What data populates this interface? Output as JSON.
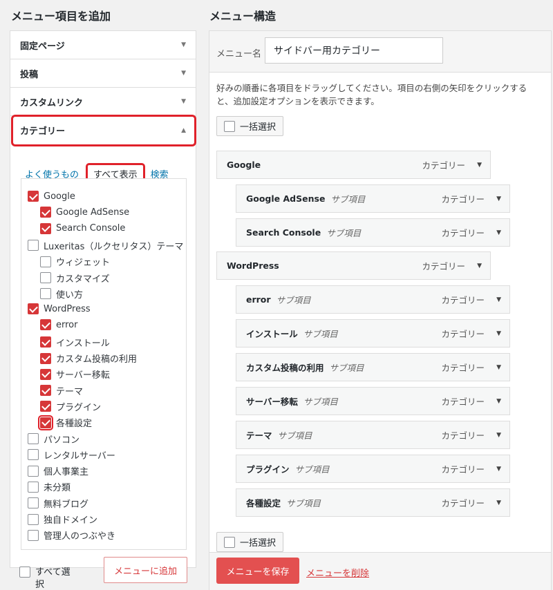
{
  "left": {
    "title": "メニュー項目を追加",
    "panels": [
      "固定ページ",
      "投稿",
      "カスタムリンク",
      "カテゴリー"
    ],
    "tabs": {
      "recent": "よく使うもの",
      "all": "すべて表示",
      "search": "検索"
    },
    "items": [
      {
        "label": "Google",
        "checked": true
      },
      {
        "label": "Google AdSense",
        "checked": true
      },
      {
        "label": "Search Console",
        "checked": true
      },
      {
        "label": "Luxeritas（ルクセリタス）テーマ",
        "checked": false
      },
      {
        "label": "ウィジェット",
        "checked": false
      },
      {
        "label": "カスタマイズ",
        "checked": false
      },
      {
        "label": "使い方",
        "checked": false
      },
      {
        "label": "WordPress",
        "checked": true
      },
      {
        "label": "error",
        "checked": true
      },
      {
        "label": "インストール",
        "checked": true
      },
      {
        "label": "カスタム投稿の利用",
        "checked": true
      },
      {
        "label": "サーバー移転",
        "checked": true
      },
      {
        "label": "テーマ",
        "checked": true
      },
      {
        "label": "プラグイン",
        "checked": true
      },
      {
        "label": "各種設定",
        "checked": true
      },
      {
        "label": "パソコン",
        "checked": false
      },
      {
        "label": "レンタルサーバー",
        "checked": false
      },
      {
        "label": "個人事業主",
        "checked": false
      },
      {
        "label": "未分類",
        "checked": false
      },
      {
        "label": "無料ブログ",
        "checked": false
      },
      {
        "label": "独自ドメイン",
        "checked": false
      },
      {
        "label": "管理人のつぶやき",
        "checked": false
      }
    ],
    "select_all": "すべて選択",
    "add_button": "メニューに追加"
  },
  "right": {
    "title": "メニュー構造",
    "name_label": "メニュー名",
    "name_value": "サイドバー用カテゴリー",
    "instructions": "好みの順番に各項目をドラッグしてください。項目の右側の矢印をクリックすると、追加設定オプションを表示できます。",
    "bulk_select": "一括選択",
    "menu_items": [
      {
        "title": "Google",
        "sub": "",
        "type": "カテゴリー"
      },
      {
        "title": "Google AdSense",
        "sub": "サブ項目",
        "type": "カテゴリー"
      },
      {
        "title": "Search Console",
        "sub": "サブ項目",
        "type": "カテゴリー"
      },
      {
        "title": "WordPress",
        "sub": "",
        "type": "カテゴリー"
      },
      {
        "title": "error",
        "sub": "サブ項目",
        "type": "カテゴリー"
      },
      {
        "title": "インストール",
        "sub": "サブ項目",
        "type": "カテゴリー"
      },
      {
        "title": "カスタム投稿の利用",
        "sub": "サブ項目",
        "type": "カテゴリー"
      },
      {
        "title": "サーバー移転",
        "sub": "サブ項目",
        "type": "カテゴリー"
      },
      {
        "title": "テーマ",
        "sub": "サブ項目",
        "type": "カテゴリー"
      },
      {
        "title": "プラグイン",
        "sub": "サブ項目",
        "type": "カテゴリー"
      },
      {
        "title": "各種設定",
        "sub": "サブ項目",
        "type": "カテゴリー"
      }
    ],
    "save_button": "メニューを保存",
    "delete_link": "メニューを削除"
  },
  "colors": {
    "accent_red": "#d63638",
    "link_blue": "#0073aa",
    "highlight": "#e0212a"
  }
}
